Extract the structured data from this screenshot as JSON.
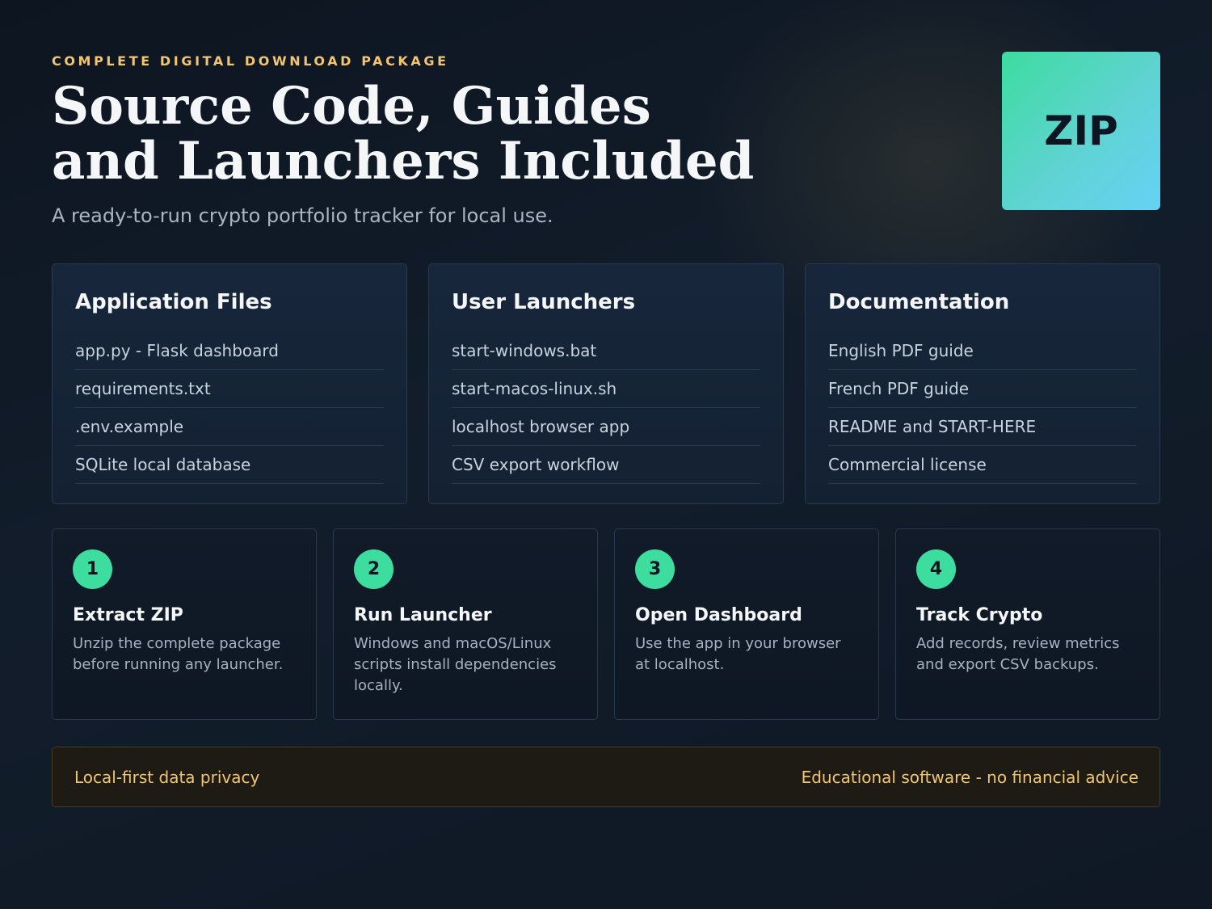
{
  "header": {
    "kicker": "COMPLETE DIGITAL DOWNLOAD PACKAGE",
    "title_line1": "Source Code, Guides",
    "title_line2": "and Launchers Included",
    "subtitle": "A ready-to-run crypto portfolio tracker for local use.",
    "badge": "ZIP"
  },
  "cards": [
    {
      "title": "Application Files",
      "items": [
        "app.py - Flask dashboard",
        "requirements.txt",
        ".env.example",
        "SQLite local database"
      ]
    },
    {
      "title": "User Launchers",
      "items": [
        "start-windows.bat",
        "start-macos-linux.sh",
        "localhost browser app",
        "CSV export workflow"
      ]
    },
    {
      "title": "Documentation",
      "items": [
        "English PDF guide",
        "French PDF guide",
        "README and START-HERE",
        "Commercial license"
      ]
    }
  ],
  "steps": [
    {
      "number": "1",
      "title": "Extract ZIP",
      "text": "Unzip the complete package before running any launcher."
    },
    {
      "number": "2",
      "title": "Run Launcher",
      "text": "Windows and macOS/Linux scripts install dependencies locally."
    },
    {
      "number": "3",
      "title": "Open Dashboard",
      "text": "Use the app in your browser at localhost."
    },
    {
      "number": "4",
      "title": "Track Crypto",
      "text": "Add records, review metrics and export CSV backups."
    }
  ],
  "footer": {
    "left": "Local-first data privacy",
    "right": "Educational software - no financial advice"
  },
  "colors": {
    "accent_gold": "#f2c66d",
    "accent_green": "#3ddc9f",
    "background": "#0d1520"
  }
}
